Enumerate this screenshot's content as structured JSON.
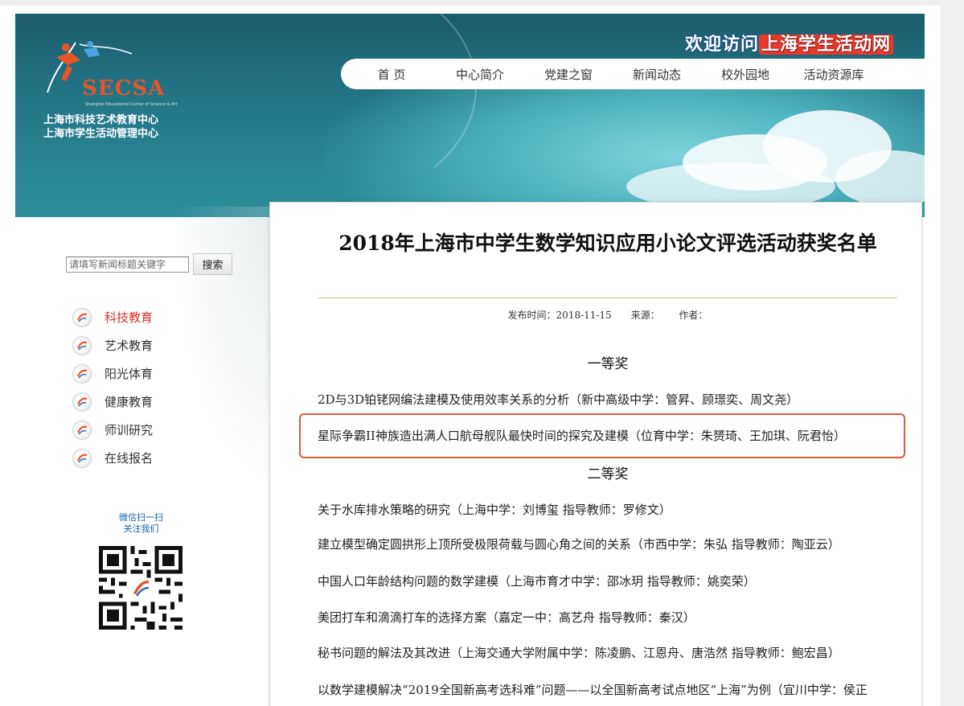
{
  "header": {
    "org_names": [
      "上海市科技艺术教育中心",
      "上海市学生活动管理中心"
    ],
    "logo_text": "SECSA",
    "logo_subtext": "Shanghai Educational Center of Science & Art",
    "welcome_prefix": "欢迎访问",
    "welcome_highlight": "上海学生活动网",
    "nav": [
      "首 页",
      "中心简介",
      "党建之窗",
      "新闻动态",
      "校外园地",
      "活动资源库"
    ]
  },
  "sidebar": {
    "search_placeholder": "请填写新闻标题关键字",
    "search_button": "搜索",
    "menu": [
      {
        "label": "科技教育",
        "active": true
      },
      {
        "label": "艺术教育",
        "active": false
      },
      {
        "label": "阳光体育",
        "active": false
      },
      {
        "label": "健康教育",
        "active": false
      },
      {
        "label": "师训研究",
        "active": false
      },
      {
        "label": "在线报名",
        "active": false
      }
    ],
    "wechat_line1": "微信扫一扫",
    "wechat_line2": "关注我们"
  },
  "article": {
    "title": "2018年上海市中学生数学知识应用小论文评选活动获奖名单",
    "publish": "发布时间：2018-11-15",
    "source": "来源：",
    "author": "作者：",
    "first_prize": "一等奖",
    "first_entries": [
      "2D与3D铂铑网编法建模及使用效率关系的分析（新中高级中学：管昇、顾璟奕、周文尧）",
      "星际争霸II神族造出满人口航母舰队最快时间的探究及建模（位育中学：朱赟琦、王加琪、阮君怡）"
    ],
    "second_prize": "二等奖",
    "second_entries": [
      "关于水库排水策略的研究（上海中学：刘博玺 指导教师：罗修文）",
      "建立模型确定圆拱形上顶所受极限荷载与圆心角之间的关系（市西中学：朱弘 指导教师：陶亚云）",
      "中国人口年龄结构问题的数学建模（上海市育才中学：邵冰玥 指导教师：姚奕荣）",
      "美团打车和滴滴打车的选择方案（嘉定一中：高艺舟 指导教师：秦汉）",
      "秘书问题的解法及其改进（上海交通大学附属中学：陈凌鹏、江恩舟、唐浩然 指导教师：鲍宏昌）",
      "以数学建模解决“2019全国新高考选科难”问题——以全国新高考试点地区“上海”为例（宜川中学：侯正"
    ]
  }
}
